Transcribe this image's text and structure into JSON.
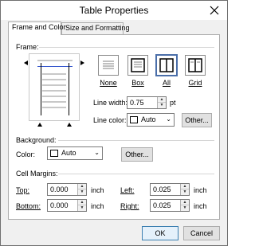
{
  "window": {
    "title": "Table Properties"
  },
  "tabs": [
    {
      "label": "Frame and Color",
      "active": true
    },
    {
      "label": "Size and Formatting",
      "active": false
    }
  ],
  "frame": {
    "section_label": "Frame:",
    "presets": [
      {
        "label": "None",
        "selected": false
      },
      {
        "label": "Box",
        "selected": false
      },
      {
        "label": "All",
        "selected": true
      },
      {
        "label": "Grid",
        "selected": false
      }
    ],
    "line_width_label": "Line width:",
    "line_width_value": "0.75",
    "line_width_unit": "pt",
    "line_color_label": "Line color:",
    "line_color_value": "Auto",
    "other_button": "Other..."
  },
  "background": {
    "section_label": "Background:",
    "color_label": "Color:",
    "color_value": "Auto",
    "other_button": "Other..."
  },
  "cell_margins": {
    "section_label": "Cell Margins:",
    "top_label": "Top:",
    "top_value": "0.000",
    "bottom_label": "Bottom:",
    "bottom_value": "0.000",
    "left_label": "Left:",
    "left_value": "0.025",
    "right_label": "Right:",
    "right_value": "0.025",
    "unit": "inch"
  },
  "buttons": {
    "ok": "OK",
    "cancel": "Cancel"
  },
  "colors": {
    "selection_border": "#4a6ea9",
    "preview_line": "#3355cc"
  },
  "icons": {
    "close": "close-icon",
    "spin_up": "spin-up-icon",
    "spin_down": "spin-down-icon",
    "dropdown": "chevron-down-icon"
  }
}
